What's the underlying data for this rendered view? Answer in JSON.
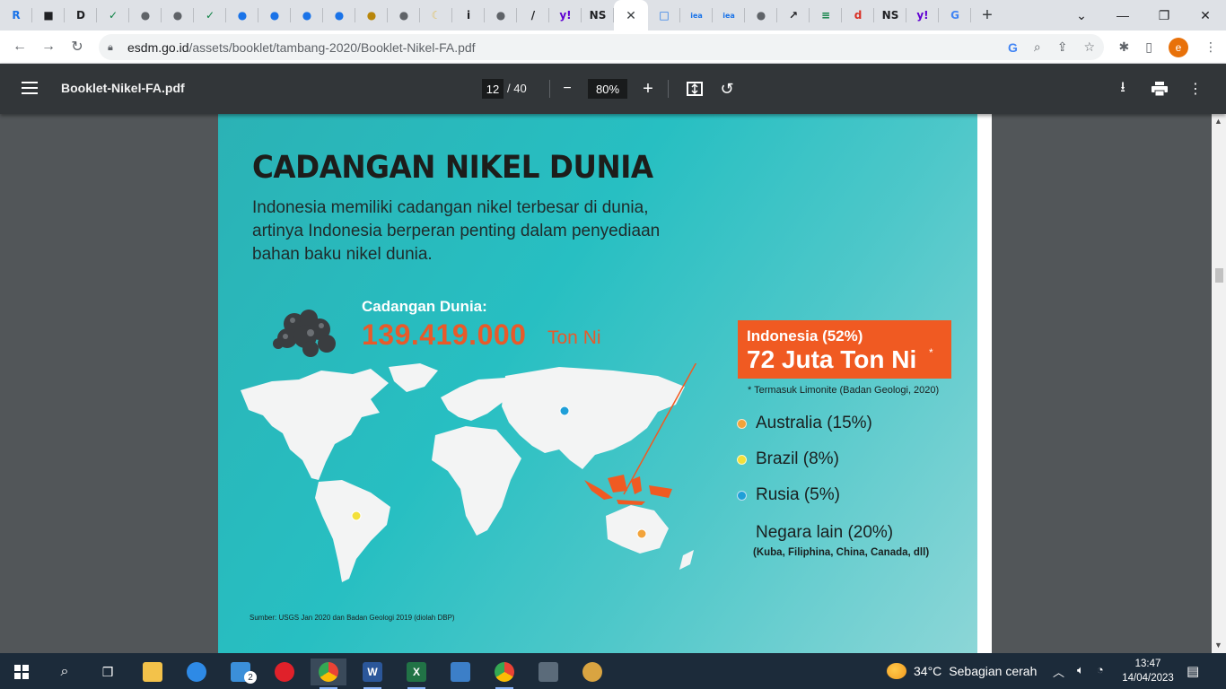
{
  "browser": {
    "tabs": [
      {
        "icon": "r-logo-icon",
        "color": "#1a73e8",
        "glyph": "R"
      },
      {
        "icon": "bookmark-icon",
        "color": "#202124",
        "glyph": "■"
      },
      {
        "icon": "d-logo-icon",
        "color": "#202124",
        "glyph": "D"
      },
      {
        "icon": "check-icon",
        "color": "#0b8043",
        "glyph": "✓"
      },
      {
        "icon": "globe-icon",
        "color": "#5f6368",
        "glyph": "●"
      },
      {
        "icon": "globe-icon",
        "color": "#5f6368",
        "glyph": "●"
      },
      {
        "icon": "check-icon",
        "color": "#0b8043",
        "glyph": "✓"
      },
      {
        "icon": "edge-icon",
        "color": "#1a73e8",
        "glyph": "●"
      },
      {
        "icon": "edge-icon",
        "color": "#1a73e8",
        "glyph": "●"
      },
      {
        "icon": "edge-icon",
        "color": "#1a73e8",
        "glyph": "●"
      },
      {
        "icon": "edge-icon",
        "color": "#1a73e8",
        "glyph": "●"
      },
      {
        "icon": "emblem-icon",
        "color": "#b8860b",
        "glyph": "●"
      },
      {
        "icon": "globe-icon",
        "color": "#5f6368",
        "glyph": "●"
      },
      {
        "icon": "moon-icon",
        "color": "#e0c060",
        "glyph": "☾"
      },
      {
        "icon": "info-icon",
        "color": "#202124",
        "glyph": "i"
      },
      {
        "icon": "globe-icon",
        "color": "#5f6368",
        "glyph": "●"
      },
      {
        "icon": "slash-icon",
        "color": "#202124",
        "glyph": "/"
      },
      {
        "icon": "yahoo-icon",
        "color": "#6001d2",
        "glyph": "y!"
      },
      {
        "icon": "ns-icon",
        "color": "#202124",
        "glyph": "NS"
      }
    ],
    "tabs_after": [
      {
        "icon": "window-icon",
        "color": "#1a73e8",
        "glyph": "□"
      },
      {
        "icon": "iea-icon",
        "color": "#1a73e8",
        "glyph": "iea"
      },
      {
        "icon": "iea-icon",
        "color": "#1a73e8",
        "glyph": "iea"
      },
      {
        "icon": "globe-icon",
        "color": "#5f6368",
        "glyph": "●"
      },
      {
        "icon": "trend-icon",
        "color": "#202124",
        "glyph": "↗"
      },
      {
        "icon": "stripes-icon",
        "color": "#0b8043",
        "glyph": "≡"
      },
      {
        "icon": "ds-icon",
        "color": "#d93025",
        "glyph": "d"
      },
      {
        "icon": "ns-icon",
        "color": "#202124",
        "glyph": "NS"
      },
      {
        "icon": "yahoo-icon",
        "color": "#6001d2",
        "glyph": "y!"
      },
      {
        "icon": "google-icon",
        "color": "#4285f4",
        "glyph": "G"
      }
    ],
    "active_tab_close": "✕",
    "new_tab": "+",
    "url_host": "esdm.go.id",
    "url_path": "/assets/booklet/tambang-2020/Booklet-Nikel-FA.pdf",
    "profile_letter": "e"
  },
  "pdf": {
    "filename": "Booklet-Nikel-FA.pdf",
    "current_page": "12",
    "total_pages": "/ 40",
    "zoom": "80%",
    "minus": "−",
    "plus": "+"
  },
  "slide": {
    "title": "CADANGAN NIKEL DUNIA",
    "intro": "Indonesia memiliki cadangan nikel terbesar di dunia, artinya Indonesia berperan penting dalam penyediaan bahan baku nikel dunia.",
    "reserve_label": "Cadangan Dunia:",
    "reserve_value": "139.419.000",
    "reserve_unit": "Ton Ni",
    "callout_line1": "Indonesia (52%)",
    "callout_line2": "72 Juta Ton Ni",
    "callout_star": "*",
    "footnote": "* Termasuk Limonite (Badan Geologi, 2020)",
    "legend": [
      {
        "label": "Australia (15%)",
        "color": "#f2a33a"
      },
      {
        "label": "Brazil (8%)",
        "color": "#f3e03a"
      },
      {
        "label": "Rusia (5%)",
        "color": "#1f9fd8"
      },
      {
        "label": "Negara lain (20%)",
        "color": ""
      }
    ],
    "other_sub": "(Kuba, Filiphina, China, Canada, dll)",
    "source": "Sumber: USGS Jan 2020 dan Badan Geologi 2019 (diolah DBP)",
    "accent": "#f05a22",
    "background": "#27bfc2"
  },
  "taskbar": {
    "temperature": "34°C",
    "weather": "Sebagian cerah",
    "time": "13:47",
    "date": "14/04/2023",
    "mail_badge": "2"
  }
}
